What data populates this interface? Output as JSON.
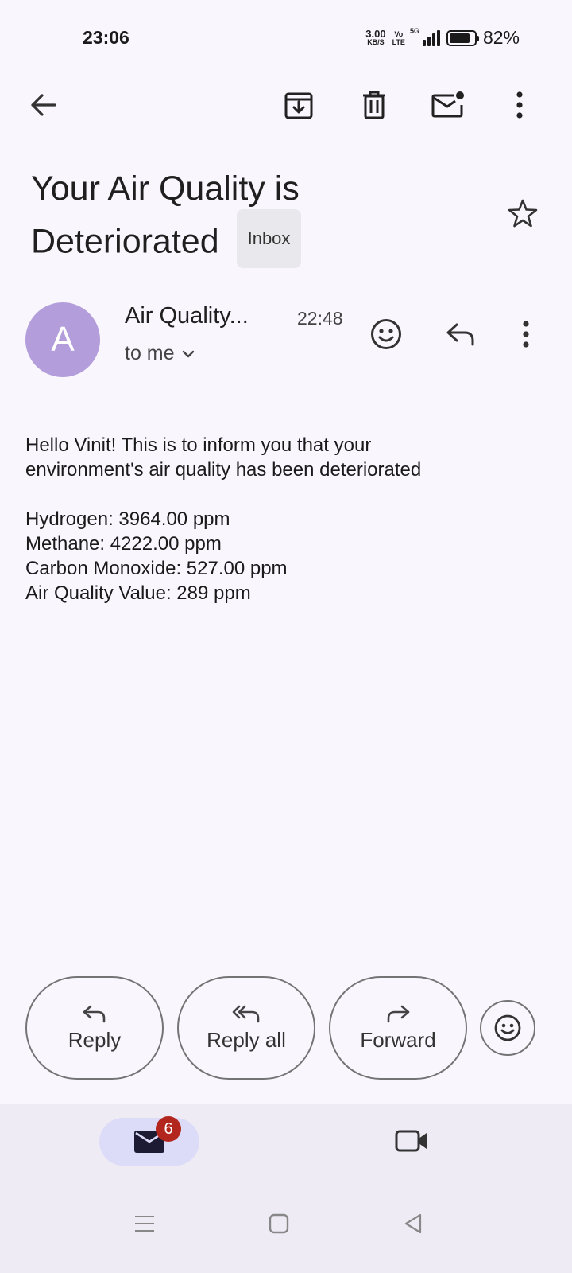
{
  "status_bar": {
    "time": "23:06",
    "net_speed_value": "3.00",
    "net_speed_unit": "KB/S",
    "volte_top": "Vo",
    "volte_bottom": "LTE",
    "network": "5G",
    "battery_percent": "82%",
    "battery_level": 0.82
  },
  "toolbar": {
    "icons": [
      "back-arrow-icon",
      "archive-icon",
      "delete-icon",
      "mark-unread-icon",
      "more-vert-icon"
    ]
  },
  "email": {
    "title_line1": "Your Air Quality is",
    "title_line2": "Deteriorated",
    "label": "Inbox",
    "avatar_letter": "A",
    "avatar_color": "#b39ddb",
    "sender": "Air Quality...",
    "time": "22:48",
    "recipient": "to me",
    "body_lines": [
      "Hello Vinit! This is to inform you that your",
      "environment's air quality has been deteriorated",
      "",
      "Hydrogen: 3964.00 ppm",
      "Methane: 4222.00 ppm",
      "Carbon Monoxide: 527.00 ppm",
      "Air Quality Value: 289 ppm"
    ]
  },
  "actions": {
    "reply": "Reply",
    "reply_all": "Reply all",
    "forward": "Forward"
  },
  "bottom_nav": {
    "mail_badge": "6",
    "badge_color": "#b3261e",
    "tabs": [
      "mail-icon",
      "video-icon"
    ]
  },
  "system_nav": [
    "menu-icon",
    "home-icon",
    "back-icon"
  ]
}
